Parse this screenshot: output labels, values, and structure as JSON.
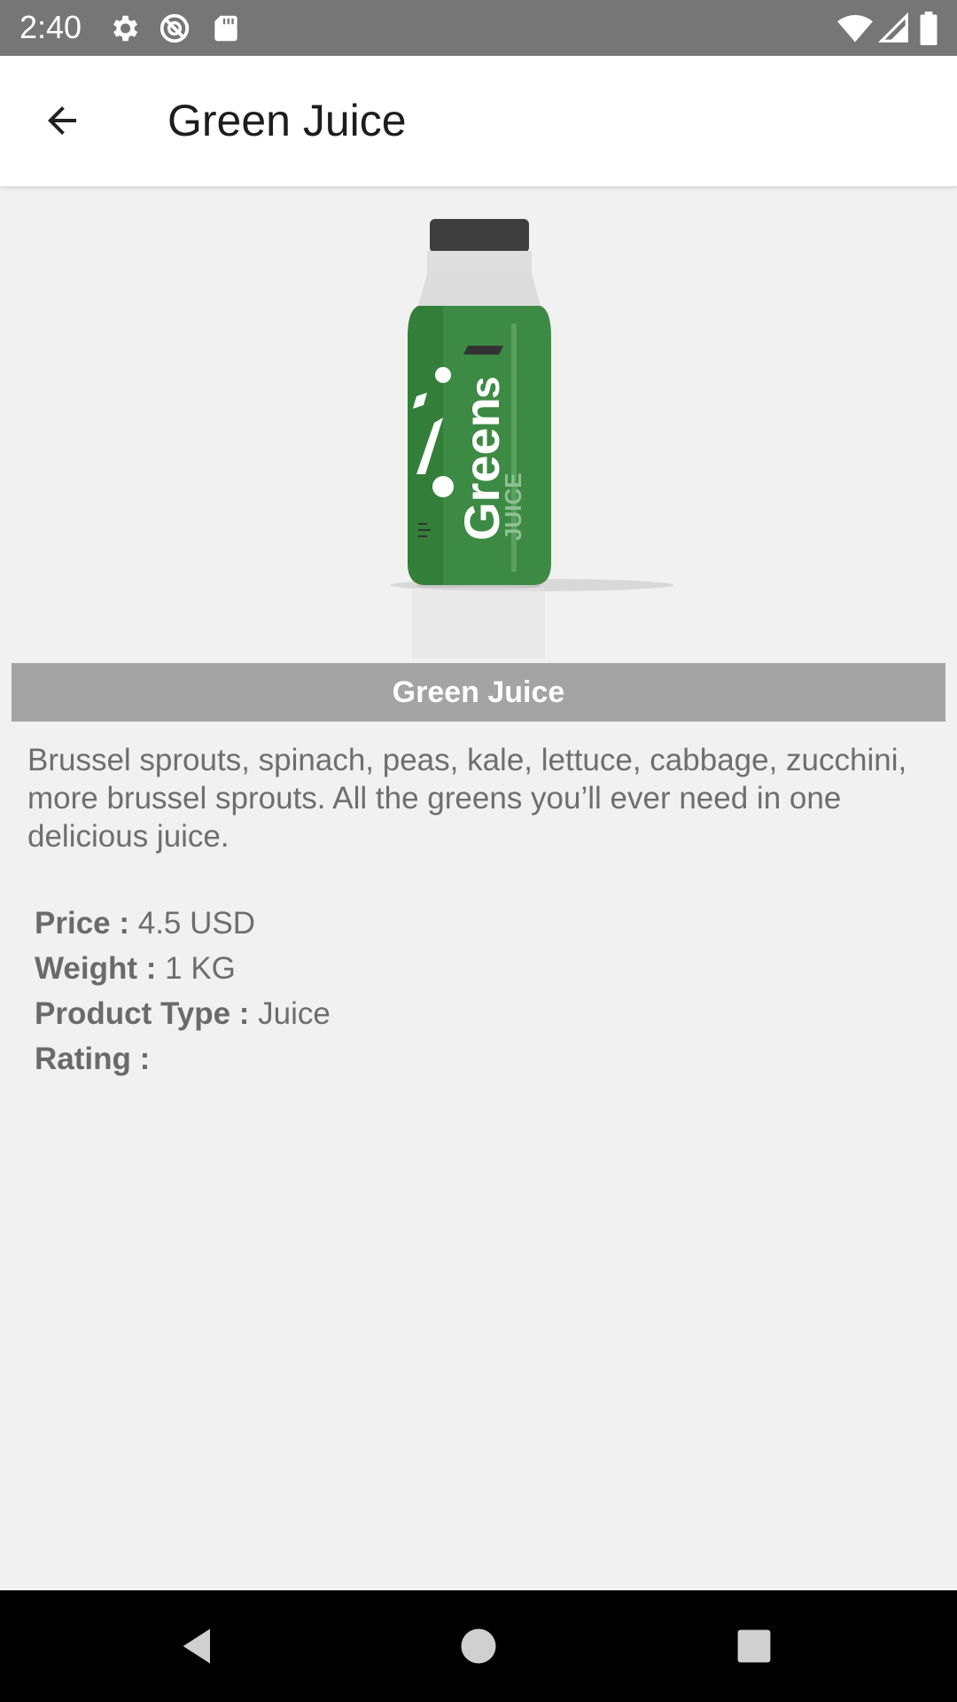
{
  "status_bar": {
    "time": "2:40",
    "icons": [
      "gear-icon",
      "no-disturb-icon",
      "sd-card-icon",
      "wifi-icon",
      "signal-icon",
      "battery-icon"
    ]
  },
  "app_bar": {
    "back_icon": "arrow-back-icon",
    "title": "Green Juice"
  },
  "product": {
    "image_label": "Greens JUICE",
    "name": "Green Juice",
    "description": "Brussel sprouts, spinach, peas, kale, lettuce, cabbage, zucchini, more brussel sprouts. All the greens you’ll ever need in one delicious juice.",
    "details": [
      {
        "label": "Price :",
        "value": "4.5 USD"
      },
      {
        "label": "Weight :",
        "value": "1 KG"
      },
      {
        "label": "Product Type :",
        "value": "Juice"
      },
      {
        "label": "Rating :",
        "value": ""
      }
    ]
  },
  "nav_bar": {
    "buttons": [
      "back-triangle-icon",
      "home-circle-icon",
      "recents-square-icon"
    ]
  },
  "colors": {
    "status_bar": "#767676",
    "banner": "#a4a4a4",
    "background": "#f1f1f1",
    "bottle_green": "#3d8a44"
  }
}
